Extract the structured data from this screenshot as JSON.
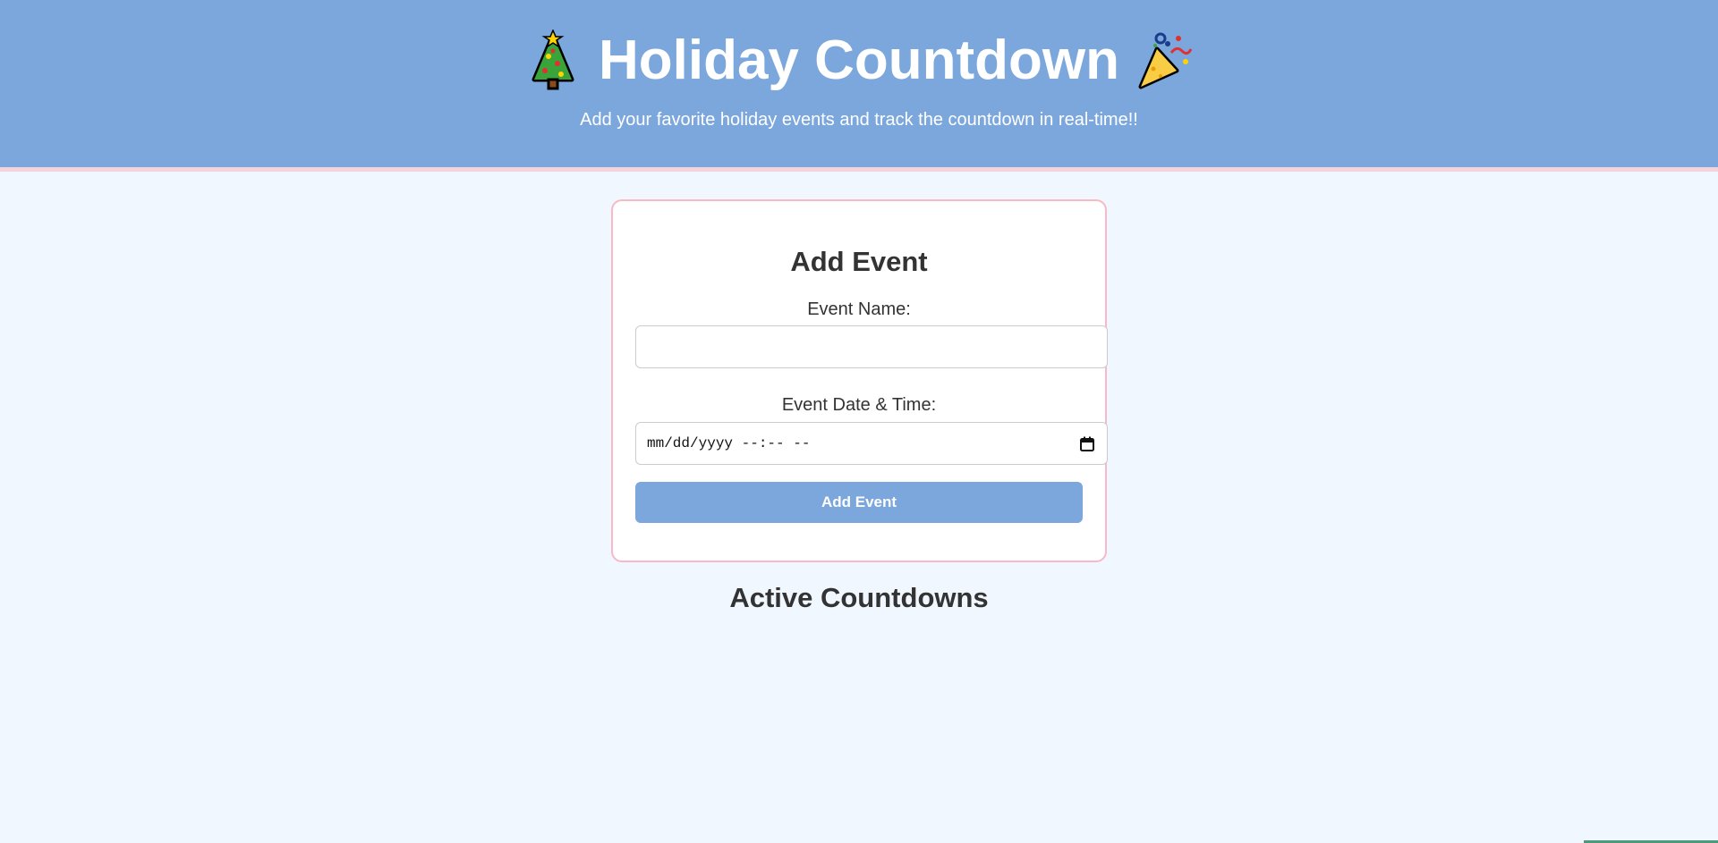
{
  "header": {
    "title": "Holiday Countdown",
    "left_icon": "christmas-tree-icon",
    "right_icon": "party-popper-icon",
    "subtitle": "Add your favorite holiday events and track the countdown in real-time!!"
  },
  "form": {
    "title": "Add Event",
    "event_name_label": "Event Name:",
    "event_name_value": "",
    "event_date_label": "Event Date & Time:",
    "event_date_placeholder": "mm/dd/yyyy --:-- --",
    "submit_label": "Add Event"
  },
  "countdowns": {
    "title": "Active Countdowns",
    "items": []
  },
  "colors": {
    "header_bg": "#7ba7dd",
    "page_bg": "#f0f7ff",
    "card_border": "#f8b9c4",
    "button_bg": "#7ba7dd"
  }
}
